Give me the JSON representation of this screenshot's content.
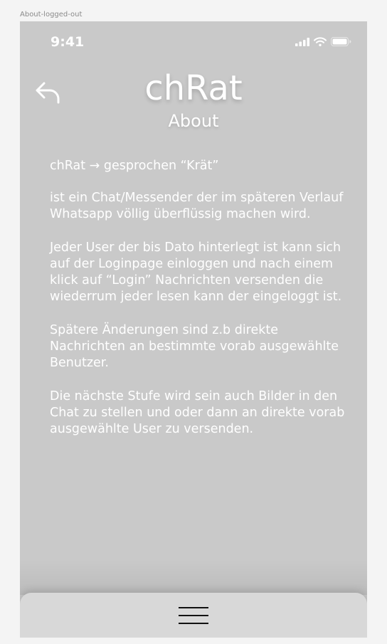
{
  "frame": {
    "label": "About-logged-out"
  },
  "status_bar": {
    "time": "9:41",
    "icons": [
      "cellular-signal-icon",
      "wifi-icon",
      "battery-icon"
    ]
  },
  "header": {
    "back_icon": "back-arrow-icon",
    "app_title": "chRat",
    "page_title": "About"
  },
  "content": {
    "paragraphs": [
      "chRat → gesprochen “Krät”",
      "ist ein Chat/Messender der im späteren Verlauf Whatsapp völlig überflüssig machen wird.",
      "Jeder User der bis Dato hinterlegt ist kann sich auf der Loginpage einloggen und nach einem klick auf “Login” Nachrichten versenden die wiederrum jeder lesen kann der eingeloggt ist.",
      "Spätere Änderungen sind z.b direkte Nachrichten an bestimmte vorab ausgewählte Benutzer.",
      "Die nächste Stufe wird sein auch Bilder in den Chat zu stellen und oder dann an direkte vorab ausgewählte User zu versenden."
    ]
  },
  "bottom_bar": {
    "menu_icon": "hamburger-menu-icon"
  },
  "colors": {
    "page_background": "#f4f4f4",
    "screen_background": "#c9c9c9",
    "bottom_bar": "#d8d8d8",
    "text": "#ffffff",
    "menu_lines": "#111111"
  }
}
